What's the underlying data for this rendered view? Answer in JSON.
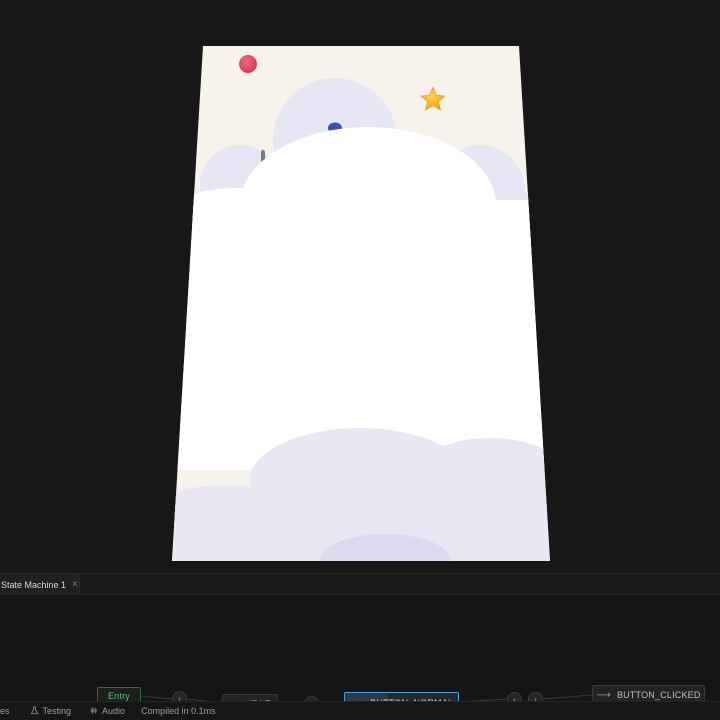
{
  "tabs": [
    {
      "label": "State Machine 1",
      "close_icon": "close-icon"
    }
  ],
  "graph": {
    "nodes": {
      "entry": "Entry",
      "idle": "IDLE",
      "button_normal": "BUTTON_NORMAL",
      "button_clicked": "BUTTON_CLICKED"
    },
    "arrow_glyph": "⟶",
    "transition_right": "›",
    "transition_left": "‹"
  },
  "status_bar": {
    "files": "es",
    "testing": "Testing",
    "audio": "Audio",
    "compiled": "Compiled in 0.1ms"
  },
  "colors": {
    "workspace": "#171717",
    "artboard_bg": "#f7f3ec",
    "cloud": "#ffffff",
    "cloud_shadow": "#e8e6f3",
    "ball_red": "#e0485e",
    "ball_blue": "#3d4fb0",
    "star": "#f5b31c",
    "entry_green": "#58c77f",
    "selected_blue": "#4f9fd6"
  },
  "icons": {
    "testing": "flask-icon",
    "audio": "audio-wave-icon"
  }
}
